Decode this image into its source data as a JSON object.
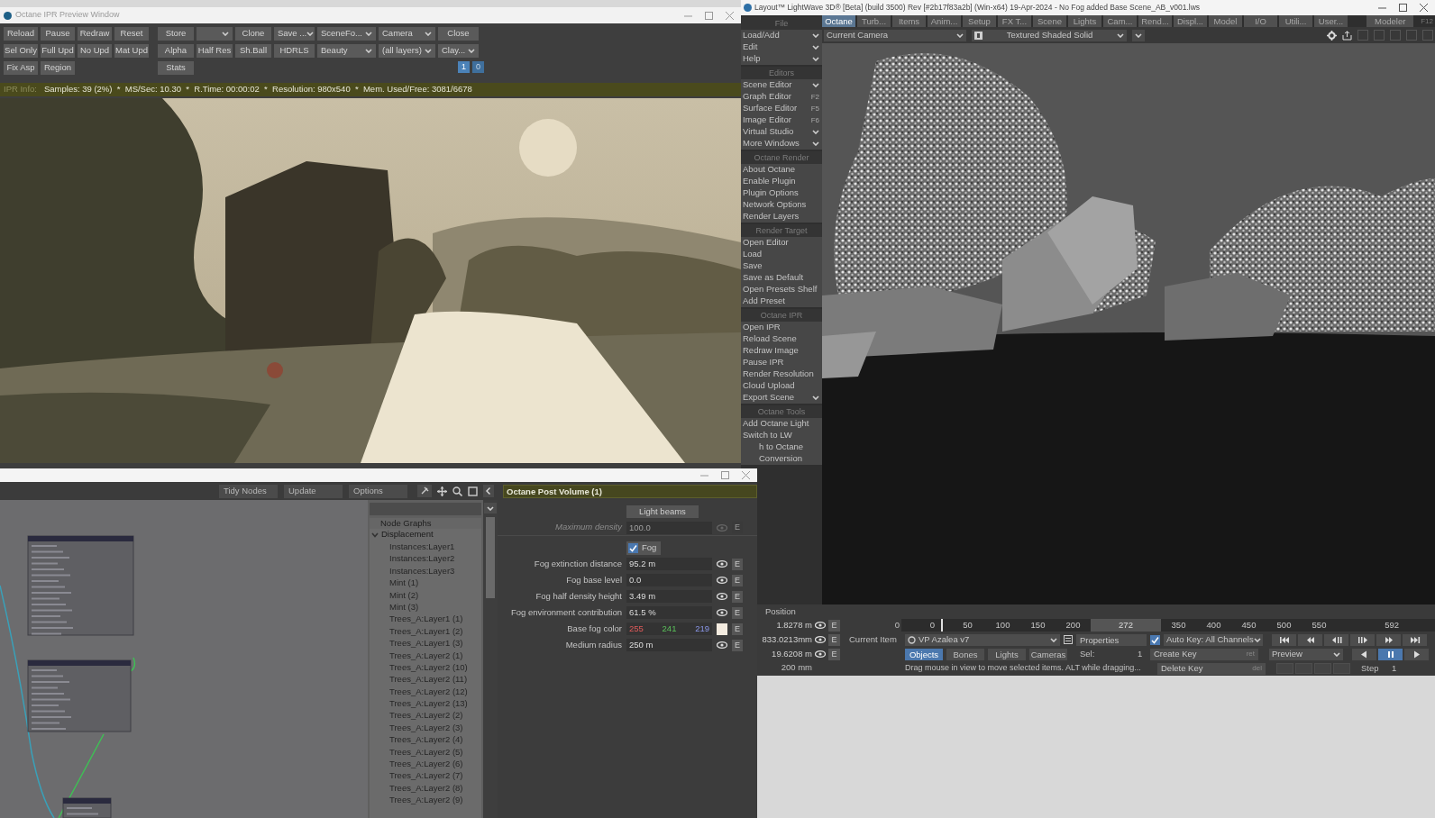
{
  "ipr_window": {
    "title": "Octane IPR Preview Window",
    "toolbar": [
      {
        "left": [
          {
            "label": "Reload",
            "kind": "button"
          },
          {
            "label": "Pause",
            "kind": "button"
          },
          {
            "label": "Redraw",
            "kind": "button"
          },
          {
            "label": "Reset",
            "kind": "button"
          }
        ],
        "right": [
          {
            "label": "Store",
            "kind": "button"
          },
          {
            "kind": "dropdown"
          },
          {
            "label": "Clone",
            "kind": "button"
          },
          {
            "label": "Save ...",
            "kind": "dropdown"
          },
          {
            "label": "SceneFo...",
            "kind": "dropdown"
          },
          {
            "label": "Camera",
            "kind": "dropdown"
          },
          {
            "label": "Close",
            "kind": "button"
          }
        ]
      },
      {
        "left": [
          {
            "label": "Sel Only",
            "kind": "button"
          },
          {
            "label": "Full Upd",
            "kind": "button"
          },
          {
            "label": "No Upd",
            "kind": "button"
          },
          {
            "label": "Mat Upd",
            "kind": "button"
          }
        ],
        "right": [
          {
            "label": "Alpha",
            "kind": "button"
          },
          {
            "label": "Half Res",
            "kind": "button"
          },
          {
            "label": "Sh.Ball",
            "kind": "button"
          },
          {
            "label": "HDRLS",
            "kind": "button"
          },
          {
            "label": "Beauty",
            "kind": "dropdown"
          },
          {
            "label": "(all layers)",
            "kind": "dropdown"
          },
          {
            "label": "Clay...",
            "kind": "dropdown"
          }
        ]
      },
      {
        "left": [
          {
            "label": "Fix Asp",
            "kind": "button"
          },
          {
            "label": "Region",
            "kind": "button"
          }
        ],
        "right": [
          {
            "label": "Stats",
            "kind": "button"
          }
        ]
      }
    ],
    "page_toggles": [
      {
        "label": "1",
        "selected": true
      },
      {
        "label": "0",
        "selected": false
      }
    ],
    "info": {
      "label": "IPR Info:",
      "text": "Samples: 39 (2%)  *  MS/Sec: 10.30  *  R.Time: 00:00:02  *  Resolution: 980x540  *  Mem. Used/Free: 3081/6678"
    }
  },
  "lightwave": {
    "title": "Layout™ LightWave 3D® [Beta] (build 3500) Rev [#2b17f83a2b] (Win-x64) 19-Apr-2024 - No Fog added Base Scene_AB_v001.lws",
    "menu_tabs": [
      {
        "label": "Octane",
        "selected": true
      },
      {
        "label": "Turb...",
        "selected": false
      },
      {
        "label": "Items",
        "selected": false
      },
      {
        "label": "Anim...",
        "selected": false
      },
      {
        "label": "Setup",
        "selected": false
      },
      {
        "label": "FX T...",
        "selected": false
      },
      {
        "label": "Scene",
        "selected": false
      },
      {
        "label": "Lights",
        "selected": false
      },
      {
        "label": "Cam...",
        "selected": false
      },
      {
        "label": "Rend...",
        "selected": false
      },
      {
        "label": "Displ...",
        "selected": false
      },
      {
        "label": "Model",
        "selected": false
      },
      {
        "label": "I/O",
        "selected": false
      },
      {
        "label": "Utili...",
        "selected": false
      },
      {
        "label": "User...",
        "selected": false
      }
    ],
    "modeler": "Modeler",
    "modeler_key": "F12",
    "viewport": {
      "camera": "Current Camera",
      "mode": "Textured Shaded Solid"
    },
    "sections": [
      {
        "title": "File",
        "items": [
          {
            "label": "Load/Add",
            "kind": "menu"
          },
          {
            "label": "Edit",
            "kind": "menu"
          },
          {
            "label": "Help",
            "kind": "menu"
          }
        ]
      },
      {
        "title": "Editors",
        "items": [
          {
            "label": "Scene Editor",
            "kind": "menu"
          },
          {
            "label": "Graph Editor",
            "kind": "item",
            "shortcut": "F2"
          },
          {
            "label": "Surface Editor",
            "kind": "item",
            "shortcut": "F5"
          },
          {
            "label": "Image Editor",
            "kind": "item",
            "shortcut": "F6"
          },
          {
            "label": "Virtual Studio",
            "kind": "menu"
          },
          {
            "label": "More Windows",
            "kind": "menu"
          }
        ]
      },
      {
        "title": "Octane Render",
        "items": [
          {
            "label": "About Octane",
            "kind": "item"
          },
          {
            "label": "Enable Plugin",
            "kind": "item"
          },
          {
            "label": "Plugin Options",
            "kind": "item"
          },
          {
            "label": "Network Options",
            "kind": "item"
          },
          {
            "label": "Render Layers",
            "kind": "item"
          }
        ]
      },
      {
        "title": "Render Target",
        "items": [
          {
            "label": "Open Editor",
            "kind": "item"
          },
          {
            "label": "Load",
            "kind": "item"
          },
          {
            "label": "Save",
            "kind": "item"
          },
          {
            "label": "Save as Default",
            "kind": "item"
          },
          {
            "label": "Open Presets Shelf",
            "kind": "item"
          },
          {
            "label": "Add Preset",
            "kind": "item"
          }
        ]
      },
      {
        "title": "Octane IPR",
        "items": [
          {
            "label": "Open IPR",
            "kind": "item"
          },
          {
            "label": "Reload Scene",
            "kind": "item"
          },
          {
            "label": "Redraw Image",
            "kind": "item"
          },
          {
            "label": "Pause IPR",
            "kind": "item"
          },
          {
            "label": "Render Resolution",
            "kind": "item"
          },
          {
            "label": "Cloud Upload",
            "kind": "item"
          },
          {
            "label": "Export Scene",
            "kind": "menu"
          }
        ]
      },
      {
        "title": "Octane Tools",
        "items": [
          {
            "label": "Add Octane Light",
            "kind": "item"
          },
          {
            "label": "Switch to LW",
            "kind": "item"
          },
          {
            "label": "h to Octane",
            "kind": "clipped"
          },
          {
            "label": "Conversion",
            "kind": "clipped"
          }
        ]
      }
    ],
    "bottom": {
      "position_label": "Position",
      "position_values": [
        {
          "value": "1.8278 m",
          "e": "E"
        },
        {
          "value": "833.0213mm",
          "e": "E"
        },
        {
          "value": "19.6208 m",
          "e": "E"
        }
      ],
      "grid_size": "200 mm",
      "start_frame": "0",
      "ticks": [
        {
          "label": "0",
          "selected": false
        },
        {
          "label": "50",
          "selected": false
        },
        {
          "label": "100",
          "selected": false
        },
        {
          "label": "150",
          "selected": false
        },
        {
          "label": "200",
          "selected": false
        },
        {
          "label": "272",
          "selected": true
        },
        {
          "label": "350",
          "selected": false
        },
        {
          "label": "400",
          "selected": false
        },
        {
          "label": "450",
          "selected": false
        },
        {
          "label": "500",
          "selected": false
        },
        {
          "label": "550",
          "selected": false
        }
      ],
      "end_frame": "592",
      "current_item_label": "Current Item",
      "current_item": "VP Azalea v7",
      "properties": "Properties",
      "auto_key": {
        "label": "Auto Key: All Channels",
        "checked": true
      },
      "item_tabs": [
        {
          "label": "Objects",
          "selected": true
        },
        {
          "label": "Bones",
          "selected": false
        },
        {
          "label": "Lights",
          "selected": false
        },
        {
          "label": "Cameras",
          "selected": false
        }
      ],
      "sel_label": "Sel:",
      "sel_value": "1",
      "create_key": {
        "label": "Create Key",
        "shortcut": "ret"
      },
      "delete_key": {
        "label": "Delete Key",
        "shortcut": "del"
      },
      "preview": "Preview",
      "playback": [
        {
          "kind": "reverse",
          "selected": false
        },
        {
          "kind": "pause",
          "selected": true
        },
        {
          "kind": "play",
          "selected": false
        }
      ],
      "status": "Drag mouse in view to move selected items. ALT while dragging...",
      "step_label": "Step",
      "step_value": "1"
    }
  },
  "node_editor": {
    "toolbar": [
      "Tidy Nodes",
      "Update",
      "Options"
    ],
    "node_graphs": {
      "header": "Node Graphs",
      "groups": [
        {
          "label": "Displacement",
          "expanded": true,
          "children": [
            {
              "label": "Instances:Layer1"
            },
            {
              "label": "Instances:Layer2"
            },
            {
              "label": "Instances:Layer3"
            },
            {
              "label": "Mint (1)"
            },
            {
              "label": "Mint (2)"
            },
            {
              "label": "Mint (3)"
            },
            {
              "label": "Trees_A:Layer1 (1)"
            },
            {
              "label": "Trees_A:Layer1 (2)"
            },
            {
              "label": "Trees_A:Layer1 (3)"
            },
            {
              "label": "Trees_A:Layer2 (1)"
            },
            {
              "label": "Trees_A:Layer2 (10)"
            },
            {
              "label": "Trees_A:Layer2 (11)"
            },
            {
              "label": "Trees_A:Layer2 (12)"
            },
            {
              "label": "Trees_A:Layer2 (13)"
            },
            {
              "label": "Trees_A:Layer2 (2)"
            },
            {
              "label": "Trees_A:Layer2 (3)"
            },
            {
              "label": "Trees_A:Layer2 (4)"
            },
            {
              "label": "Trees_A:Layer2 (5)"
            },
            {
              "label": "Trees_A:Layer2 (6)"
            },
            {
              "label": "Trees_A:Layer2 (7)"
            },
            {
              "label": "Trees_A:Layer2 (8)"
            },
            {
              "label": "Trees_A:Layer2 (9)"
            }
          ]
        }
      ]
    },
    "panel": {
      "title": "Octane Post Volume (1)",
      "light_beams": "Light beams",
      "max_density": {
        "label": "Maximum density",
        "value": "100.0",
        "disabled": true,
        "e": "E"
      },
      "fog": {
        "label": "Fog",
        "checked": true
      },
      "params": [
        {
          "kind": "field",
          "label": "Fog extinction distance",
          "value": "95.2 m",
          "e": "E"
        },
        {
          "kind": "field",
          "label": "Fog base level",
          "value": "0.0",
          "e": "E"
        },
        {
          "kind": "field",
          "label": "Fog half density height",
          "value": "3.49 m",
          "e": "E"
        },
        {
          "kind": "field",
          "label": "Fog environment contribution",
          "value": "61.5 %",
          "e": "E"
        },
        {
          "kind": "color",
          "label": "Base fog color",
          "r": "255",
          "g": "241",
          "b": "219",
          "color": "#f4ece0",
          "e": "E"
        },
        {
          "kind": "field",
          "label": "Medium radius",
          "value": "250 m",
          "e": "E"
        }
      ]
    }
  }
}
